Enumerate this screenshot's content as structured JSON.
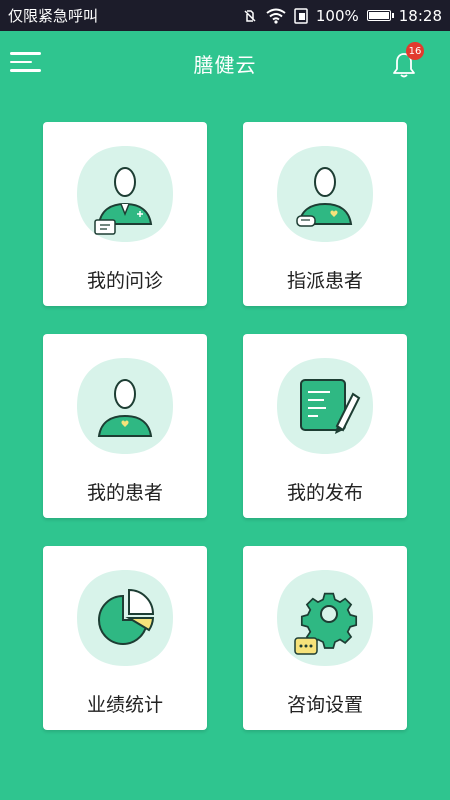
{
  "status_bar": {
    "carrier": "仅限紧急呼叫",
    "battery": "100%",
    "time": "18:28"
  },
  "app_bar": {
    "title": "膳健云",
    "notification_count": "16"
  },
  "colors": {
    "primary": "#2fc58f",
    "icon_bg": "#d8f3ea",
    "icon_fill": "#2fb883",
    "accent_yellow": "#f6e27a"
  },
  "menu": [
    {
      "label": "我的问诊",
      "icon": "doctor-chat-icon"
    },
    {
      "label": "指派患者",
      "icon": "assign-patient-icon"
    },
    {
      "label": "我的患者",
      "icon": "patient-icon"
    },
    {
      "label": "我的发布",
      "icon": "publish-edit-icon"
    },
    {
      "label": "业绩统计",
      "icon": "pie-chart-icon"
    },
    {
      "label": "咨询设置",
      "icon": "settings-gear-icon"
    }
  ]
}
